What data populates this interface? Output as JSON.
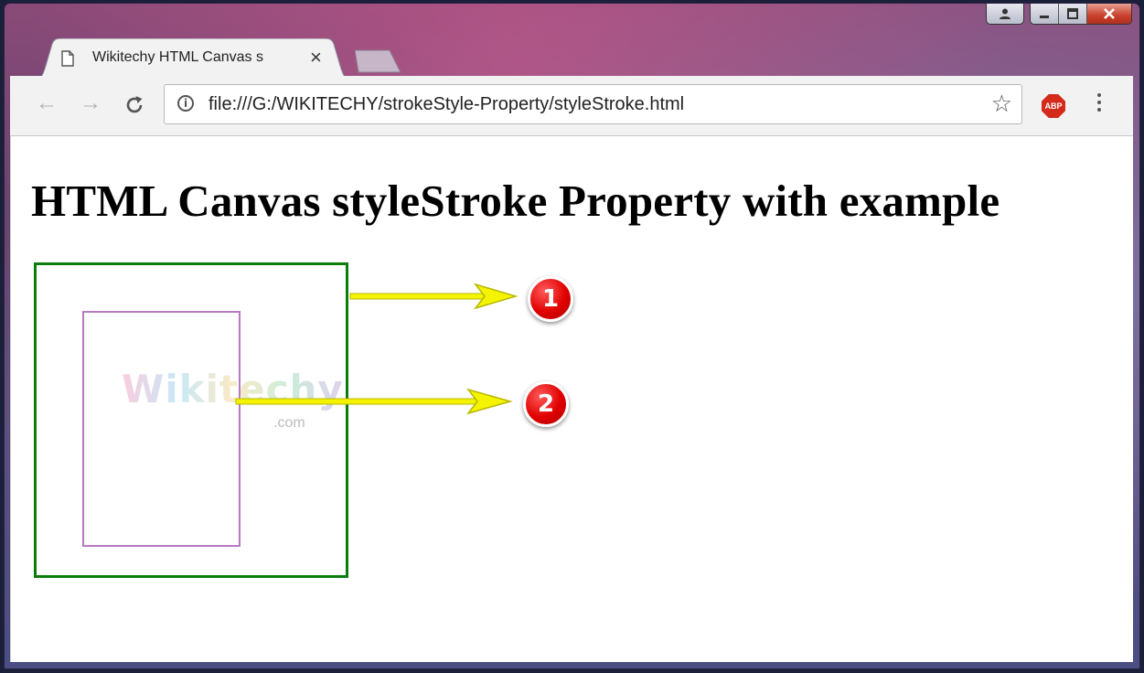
{
  "window": {
    "caption_buttons": [
      "user",
      "minimize",
      "maximize",
      "close"
    ]
  },
  "tab": {
    "title": "Wikitechy HTML Canvas s",
    "close_label": "×"
  },
  "toolbar": {
    "back_icon": "←",
    "forward_icon": "→",
    "reload_icon": "C",
    "url": "file:///G:/WIKITECHY/strokeStyle-Property/styleStroke.html",
    "bookmark_icon": "☆",
    "adblock_label": "ABP"
  },
  "page": {
    "heading": "HTML Canvas styleStroke Property with example",
    "watermark": "Wikitechy",
    "watermark_suffix": ".com",
    "outer_rect_color": "#0b7d0b",
    "inner_rect_color": "#b679c2"
  },
  "annotations": [
    {
      "label": "1",
      "arrow_color": "#f4f400"
    },
    {
      "label": "2",
      "arrow_color": "#f4f400"
    }
  ]
}
